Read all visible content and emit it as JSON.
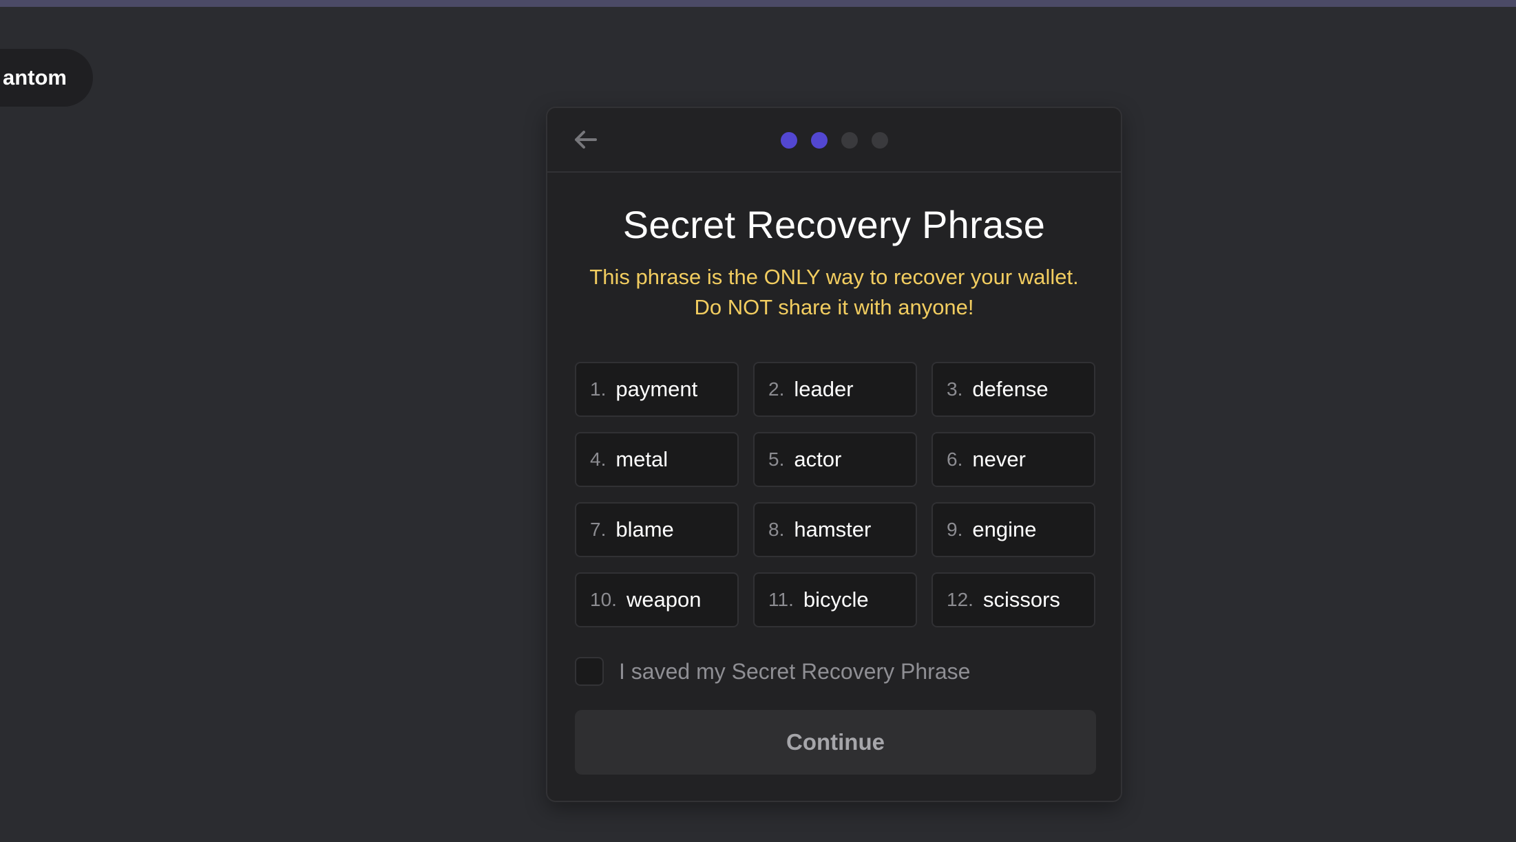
{
  "brand": {
    "label": "antom"
  },
  "header": {
    "progress": {
      "current_step": 2,
      "total_steps": 4
    }
  },
  "main": {
    "title": "Secret Recovery Phrase",
    "warning": "This phrase is the ONLY way to recover your wallet. Do NOT share it with anyone!",
    "words": [
      {
        "num": "1.",
        "word": "payment"
      },
      {
        "num": "2.",
        "word": "leader"
      },
      {
        "num": "3.",
        "word": "defense"
      },
      {
        "num": "4.",
        "word": "metal"
      },
      {
        "num": "5.",
        "word": "actor"
      },
      {
        "num": "6.",
        "word": "never"
      },
      {
        "num": "7.",
        "word": "blame"
      },
      {
        "num": "8.",
        "word": "hamster"
      },
      {
        "num": "9.",
        "word": "engine"
      },
      {
        "num": "10.",
        "word": "weapon"
      },
      {
        "num": "11.",
        "word": "bicycle"
      },
      {
        "num": "12.",
        "word": "scissors"
      }
    ],
    "confirm_label": "I saved my Secret Recovery Phrase",
    "confirm_checked": false,
    "continue_label": "Continue"
  },
  "colors": {
    "accent": "#5347d1",
    "warning": "#f2cd60",
    "background": "#2b2c30",
    "card": "#222224"
  },
  "icons": {
    "back": "arrow-left-icon"
  }
}
